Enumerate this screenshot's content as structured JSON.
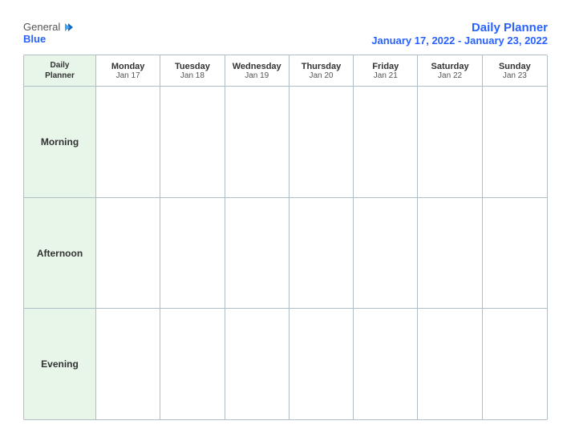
{
  "logo": {
    "general": "General",
    "blue": "Blue",
    "icon_unicode": "▶"
  },
  "header": {
    "title": "Daily Planner",
    "date_range": "January 17, 2022 - January 23, 2022"
  },
  "calendar": {
    "first_col_header_line1": "Daily",
    "first_col_header_line2": "Planner",
    "days": [
      {
        "name": "Monday",
        "date": "Jan 17"
      },
      {
        "name": "Tuesday",
        "date": "Jan 18"
      },
      {
        "name": "Wednesday",
        "date": "Jan 19"
      },
      {
        "name": "Thursday",
        "date": "Jan 20"
      },
      {
        "name": "Friday",
        "date": "Jan 21"
      },
      {
        "name": "Saturday",
        "date": "Jan 22"
      },
      {
        "name": "Sunday",
        "date": "Jan 23"
      }
    ],
    "rows": [
      {
        "label": "Morning"
      },
      {
        "label": "Afternoon"
      },
      {
        "label": "Evening"
      }
    ]
  }
}
